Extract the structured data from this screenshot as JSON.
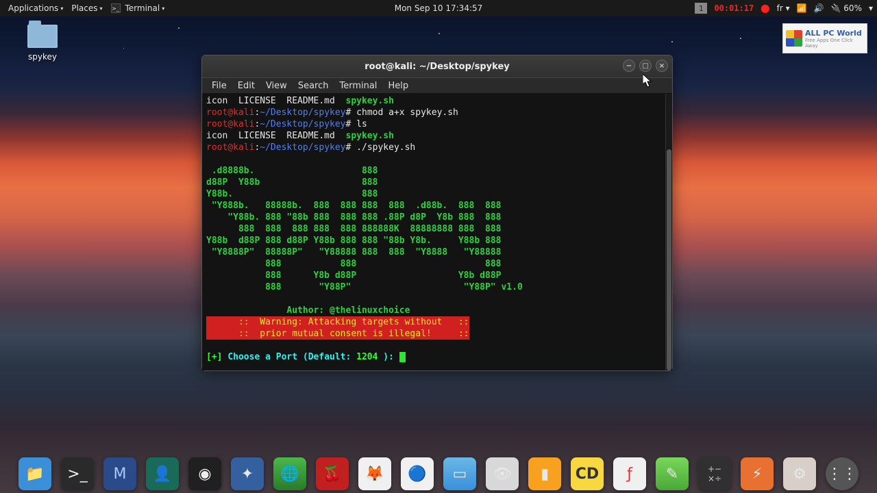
{
  "topbar": {
    "apps": "Applications",
    "places": "Places",
    "terminal": "Terminal",
    "clock": "Mon Sep 10  17:34:57",
    "workspace": "1",
    "rec_time": "00:01:17",
    "lang": "fr",
    "battery": "60%"
  },
  "desktop": {
    "folder_name": "spykey"
  },
  "watermark": {
    "line1": "ALL PC World",
    "line2": "Free Apps One Click Away"
  },
  "window": {
    "title": "root@kali: ~/Desktop/spykey",
    "menus": {
      "file": "File",
      "edit": "Edit",
      "view": "View",
      "search": "Search",
      "terminal": "Terminal",
      "help": "Help"
    }
  },
  "term": {
    "ls1_files": "icon  LICENSE  README.md  ",
    "ls1_sh": "spykey.sh",
    "prompt_user": "root@kali",
    "prompt_path": "~/Desktop/spykey",
    "cmd_chmod": " chmod a+x spykey.sh",
    "cmd_ls": " ls",
    "ls2_files": "icon  LICENSE  README.md  ",
    "ls2_sh": "spykey.sh",
    "cmd_run": " ./spykey.sh",
    "banner": " .d8888b.                    888\nd88P  Y88b                   888\nY88b.                        888\n \"Y888b.   88888b.  888  888 888  888  .d88b.  888  888\n    \"Y88b. 888 \"88b 888  888 888 .88P d8P  Y8b 888  888\n      888  888  888 888  888 888888K  88888888 888  888\nY88b  d88P 888 d88P Y88b 888 888 \"88b Y8b.     Y88b 888\n \"Y8888P\"  88888P\"   \"Y88888 888  888  \"Y8888   \"Y88888\n           888           888                        888\n           888      Y8b d88P                   Y8b d88P\n           888       \"Y88P\"                     \"Y88P\" v1.0",
    "author": "               Author: @thelinuxchoice",
    "warn1": "      ::  Warning: Attacking targets without   ::",
    "warn2": "      ::  prior mutual consent is illegal!     ::",
    "prompt_port_a": "[+] ",
    "prompt_port_b": "Choose a Port (Default: ",
    "prompt_port_c": "1204 ",
    "prompt_port_d": "): "
  }
}
